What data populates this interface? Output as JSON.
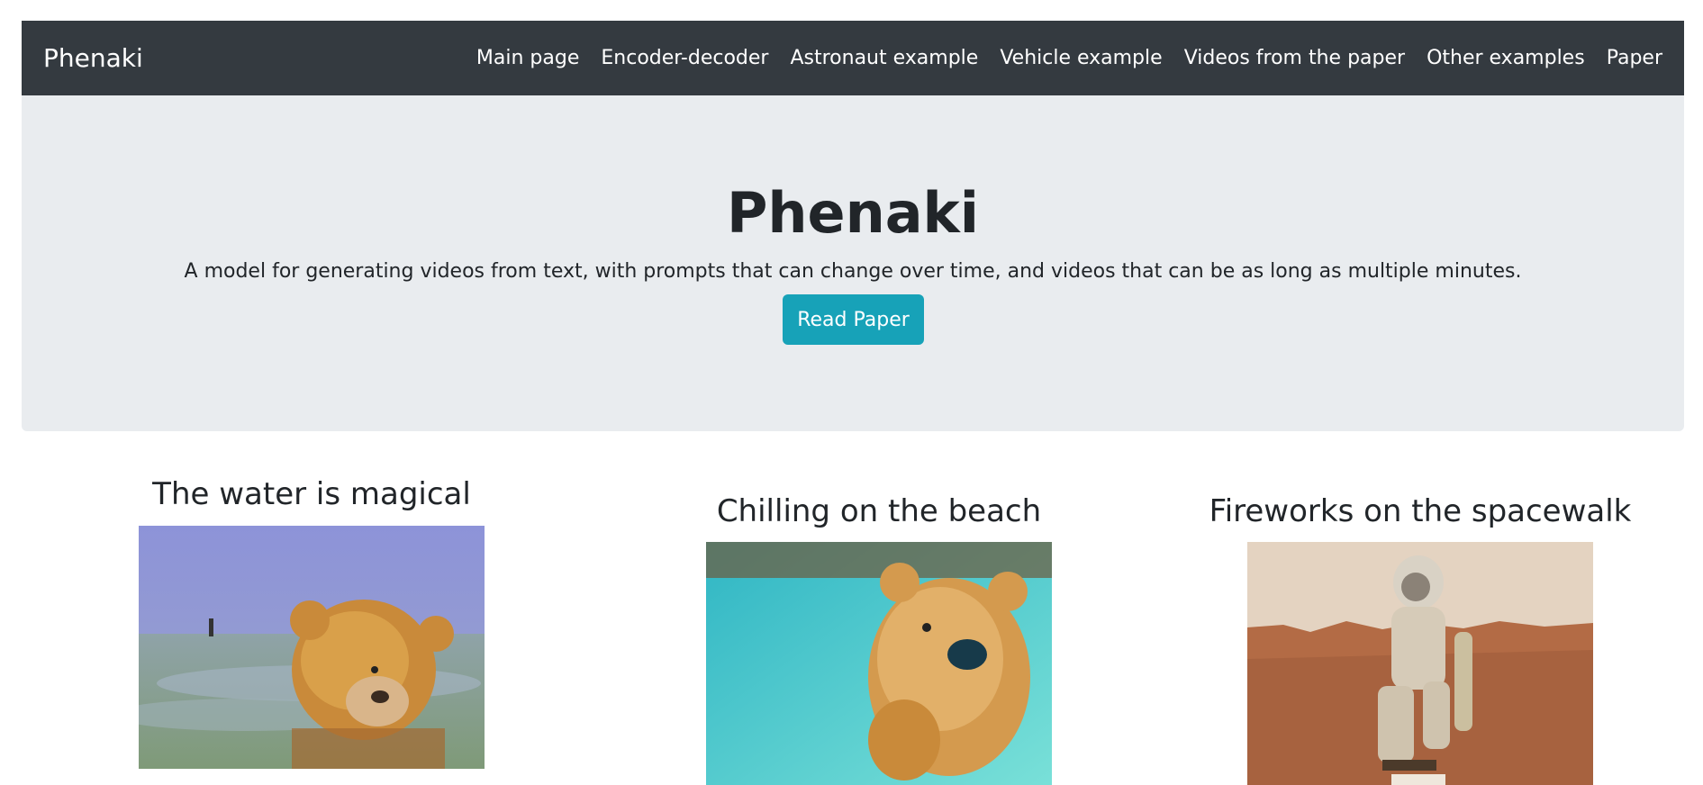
{
  "navbar": {
    "brand": "Phenaki",
    "links": [
      {
        "label": "Main page"
      },
      {
        "label": "Encoder-decoder"
      },
      {
        "label": "Astronaut example"
      },
      {
        "label": "Vehicle example"
      },
      {
        "label": "Videos from the paper"
      },
      {
        "label": "Other examples"
      },
      {
        "label": "Paper"
      }
    ]
  },
  "hero": {
    "title": "Phenaki",
    "lead": "A model for generating videos from text, with prompts that can change over time, and videos that can be as long as multiple minutes.",
    "button_label": "Read Paper"
  },
  "videos": [
    {
      "title": "The water is magical"
    },
    {
      "title": "Chilling on the beach"
    },
    {
      "title": "Fireworks on the spacewalk"
    }
  ],
  "colors": {
    "navbar_bg": "#343a40",
    "jumbotron_bg": "#e9ecef",
    "button_bg": "#17a2b8"
  }
}
